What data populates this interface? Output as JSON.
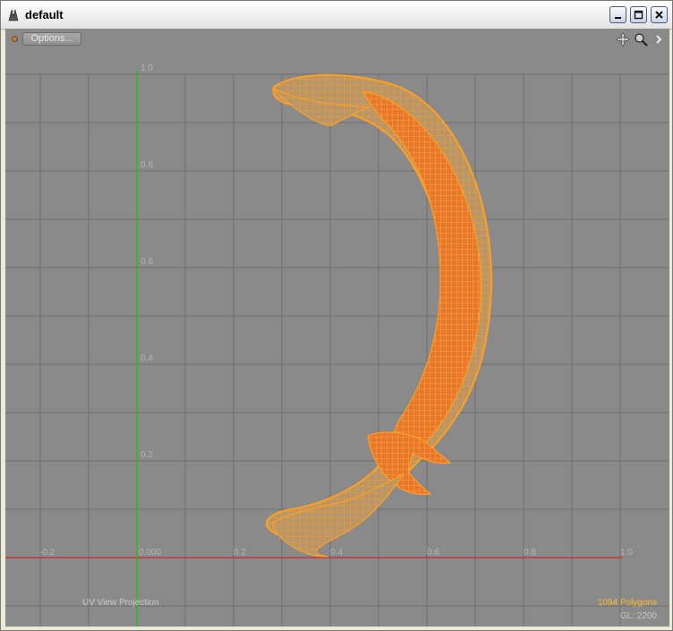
{
  "window": {
    "title": "default",
    "buttons": [
      "minimize",
      "maximize",
      "close"
    ]
  },
  "toolbar": {
    "options_label": "Options...",
    "icons": [
      "pan-icon",
      "zoom-icon",
      "arrow-right-icon"
    ]
  },
  "viewport": {
    "mode_label": "UV View Projection",
    "polygon_count": "1094 Polygons",
    "gl_info": "GL: 2200",
    "colors": {
      "background": "#8a8a8a",
      "grid": "#6e6e6e",
      "u_axis": "#e01010",
      "v_axis": "#00d000",
      "wire": "#ffa020",
      "fill": "#e05a20"
    }
  },
  "axes": {
    "u_ticks": [
      "-0.2",
      "0.000",
      "0.2",
      "0.4",
      "0.6",
      "0.8",
      "1.0"
    ],
    "v_ticks": [
      "0.2",
      "0.4",
      "0.6",
      "0.8",
      "1.0"
    ]
  }
}
